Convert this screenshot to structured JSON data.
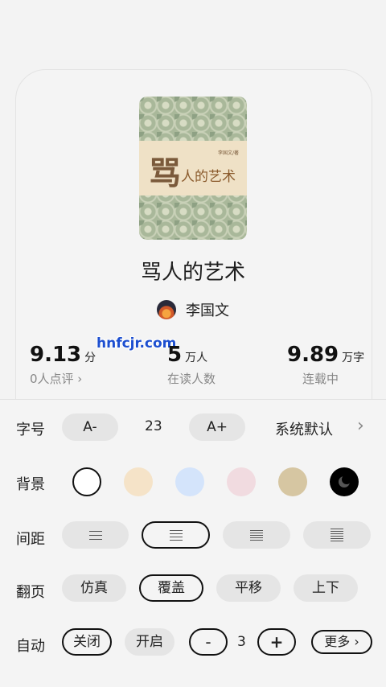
{
  "book": {
    "cover": {
      "big_char": "骂",
      "title": "人的艺术",
      "author": "李国文/著"
    },
    "title": "骂人的艺术",
    "author": "李国文"
  },
  "watermark": "hnfcjr.com",
  "stats": {
    "score": {
      "value": "9.13",
      "unit": "分",
      "label": "0人点评 ›"
    },
    "readers": {
      "value": "5",
      "unit": "万人",
      "label": "在读人数"
    },
    "words": {
      "value": "9.89",
      "unit": "万字",
      "label": "连载中"
    }
  },
  "settings": {
    "font": {
      "label": "字号",
      "decrease": "A-",
      "size": "23",
      "increase": "A+",
      "family": "系统默认",
      "chevron": "›"
    },
    "background": {
      "label": "背景",
      "colors": [
        "#ffffff",
        "#f5e3c8",
        "#d4e4fb",
        "#f1dbe0",
        "#d6c6a2",
        "#000000"
      ],
      "selected_index": 0
    },
    "spacing": {
      "label": "间距",
      "selected_index": 1
    },
    "page_turn": {
      "label": "翻页",
      "options": [
        "仿真",
        "覆盖",
        "平移",
        "上下"
      ],
      "selected_index": 1
    },
    "auto": {
      "label": "自动",
      "off": "关闭",
      "on": "开启",
      "minus": "-",
      "value": "3",
      "plus": "+",
      "more": "更多 ›",
      "selected": "关闭"
    }
  }
}
